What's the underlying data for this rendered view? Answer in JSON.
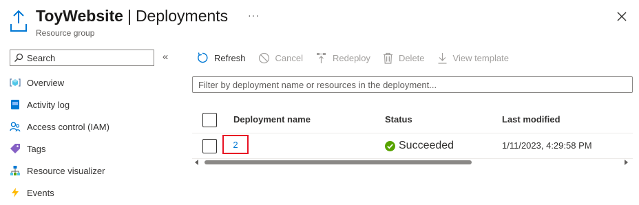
{
  "header": {
    "resource_name": "ToyWebsite",
    "separator": "|",
    "page_title": "Deployments",
    "subtitle": "Resource group",
    "more_label": "···",
    "icon": "resource-group-upload-icon",
    "close_icon": "close-icon"
  },
  "sidebar": {
    "search": {
      "placeholder": "Search",
      "value": ""
    },
    "collapse_label": "«",
    "items": [
      {
        "label": "Overview",
        "icon": "overview-cube-icon"
      },
      {
        "label": "Activity log",
        "icon": "activity-log-icon"
      },
      {
        "label": "Access control (IAM)",
        "icon": "access-control-icon"
      },
      {
        "label": "Tags",
        "icon": "tag-icon"
      },
      {
        "label": "Resource visualizer",
        "icon": "resource-visualizer-icon"
      },
      {
        "label": "Events",
        "icon": "lightning-icon"
      }
    ]
  },
  "toolbar": {
    "refresh": {
      "label": "Refresh",
      "icon": "refresh-icon",
      "enabled": true
    },
    "cancel": {
      "label": "Cancel",
      "icon": "cancel-icon",
      "enabled": false
    },
    "redeploy": {
      "label": "Redeploy",
      "icon": "redeploy-icon",
      "enabled": false
    },
    "delete": {
      "label": "Delete",
      "icon": "trash-icon",
      "enabled": false
    },
    "view_template": {
      "label": "View template",
      "icon": "download-icon",
      "enabled": false
    }
  },
  "filter": {
    "placeholder": "Filter by deployment name or resources in the deployment...",
    "value": ""
  },
  "table": {
    "columns": [
      "Deployment name",
      "Status",
      "Last modified"
    ],
    "rows": [
      {
        "deployment_name": "2",
        "status": "Succeeded",
        "status_icon": "check-circle-icon",
        "last_modified": "1/11/2023, 4:29:58 PM",
        "selected": false
      }
    ]
  },
  "colors": {
    "accent": "#0078d4",
    "success": "#57a300",
    "highlight": "#e81123",
    "disabled_text": "#a19f9d"
  },
  "scrollbar": {
    "visible_fraction": 0.64,
    "position": 0
  }
}
